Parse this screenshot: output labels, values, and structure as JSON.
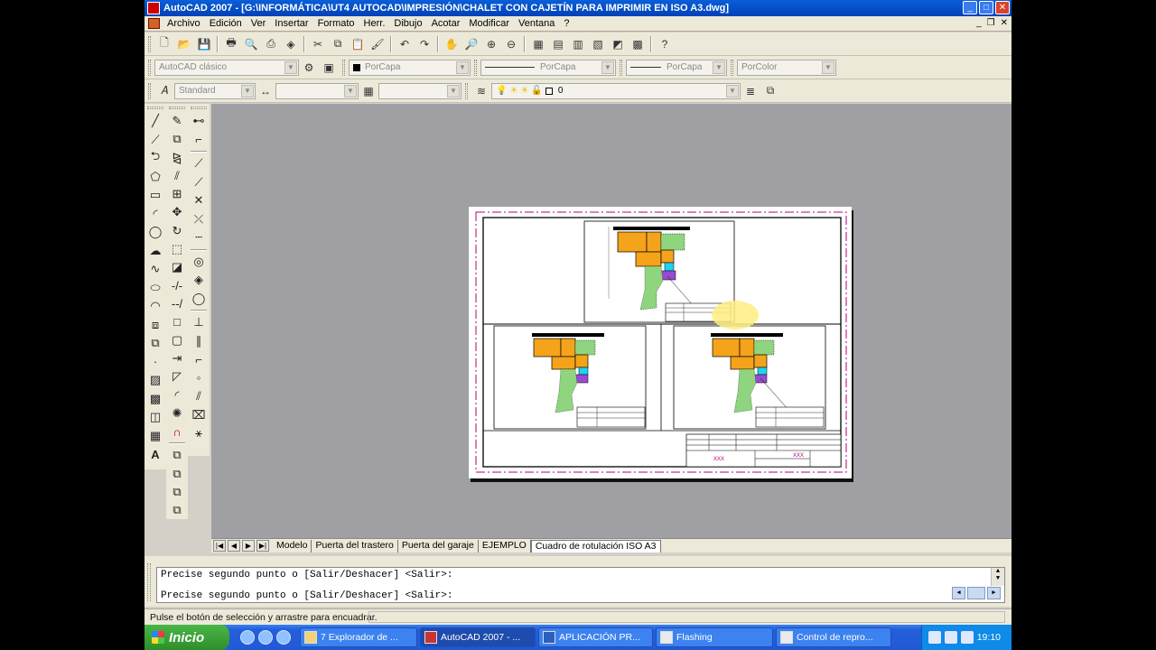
{
  "window": {
    "title": "AutoCAD 2007 - [G:\\INFORMÁTICA\\UT4 AUTOCAD\\IMPRESIÓN\\CHALET CON CAJETÍN PARA IMPRIMIR EN ISO A3.dwg]"
  },
  "menu": [
    "Archivo",
    "Edición",
    "Ver",
    "Insertar",
    "Formato",
    "Herr.",
    "Dibujo",
    "Acotar",
    "Modificar",
    "Ventana",
    "?"
  ],
  "workspace": {
    "value": "AutoCAD clásico"
  },
  "properties": {
    "layer_color": "PorCapa",
    "linetype": "PorCapa",
    "lineweight": "PorCapa",
    "plotstyle": "PorColor"
  },
  "styles": {
    "text_style": "Standard"
  },
  "layers": {
    "current": "0"
  },
  "layout_tabs": {
    "tabs": [
      "Modelo",
      "Puerta del trastero",
      "Puerta del garaje",
      "EJEMPLO",
      "Cuadro de rotulación ISO A3"
    ],
    "active_index": 4
  },
  "command": {
    "line1": "Precise segundo punto o [Salir/Deshacer] <Salir>:",
    "line2": "Precise segundo punto o [Salir/Deshacer] <Salir>:"
  },
  "status": {
    "text": "Pulse el botón de selección y arrastre para encuadrar."
  },
  "taskbar": {
    "start": "Inicio",
    "tasks": [
      "7 Explorador de ...",
      "AutoCAD 2007 - ...",
      "APLICACIÓN PR...",
      "Flashing",
      "Control de repro..."
    ],
    "active_task_index": 1,
    "clock": "19:10"
  },
  "sheet": {
    "title_block_text": "XXX",
    "colors": {
      "plan_orange": "#f4a31a",
      "plan_green": "#8fd47f",
      "plan_purple": "#9a4ad0",
      "plan_cyan": "#1fd3f0",
      "frame_magenta": "#b0007a",
      "highlight": "#ffef80"
    }
  }
}
